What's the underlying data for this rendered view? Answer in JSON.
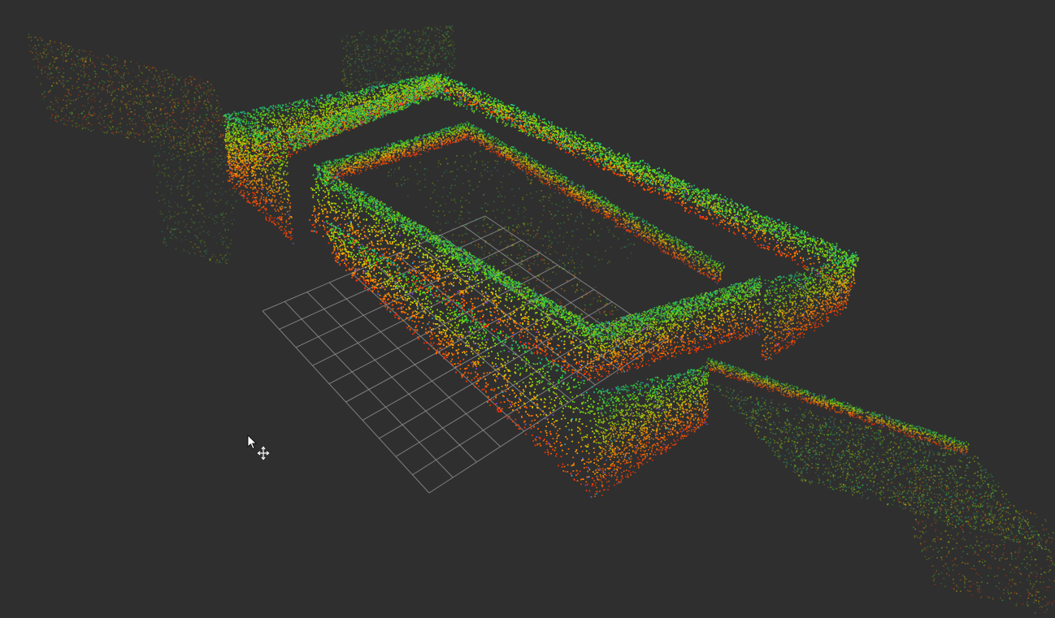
{
  "viewport": {
    "background_color": "#2f2f2f",
    "grid_color": "#9a9a9a",
    "point_palette": [
      "#ff3300",
      "#ff6600",
      "#ff9900",
      "#cccc00",
      "#88dd00",
      "#33cc33",
      "#22bb88",
      "#33aacc",
      "#5566dd",
      "#8844cc"
    ]
  },
  "cursor": {
    "icon": "move-cursor-icon"
  }
}
